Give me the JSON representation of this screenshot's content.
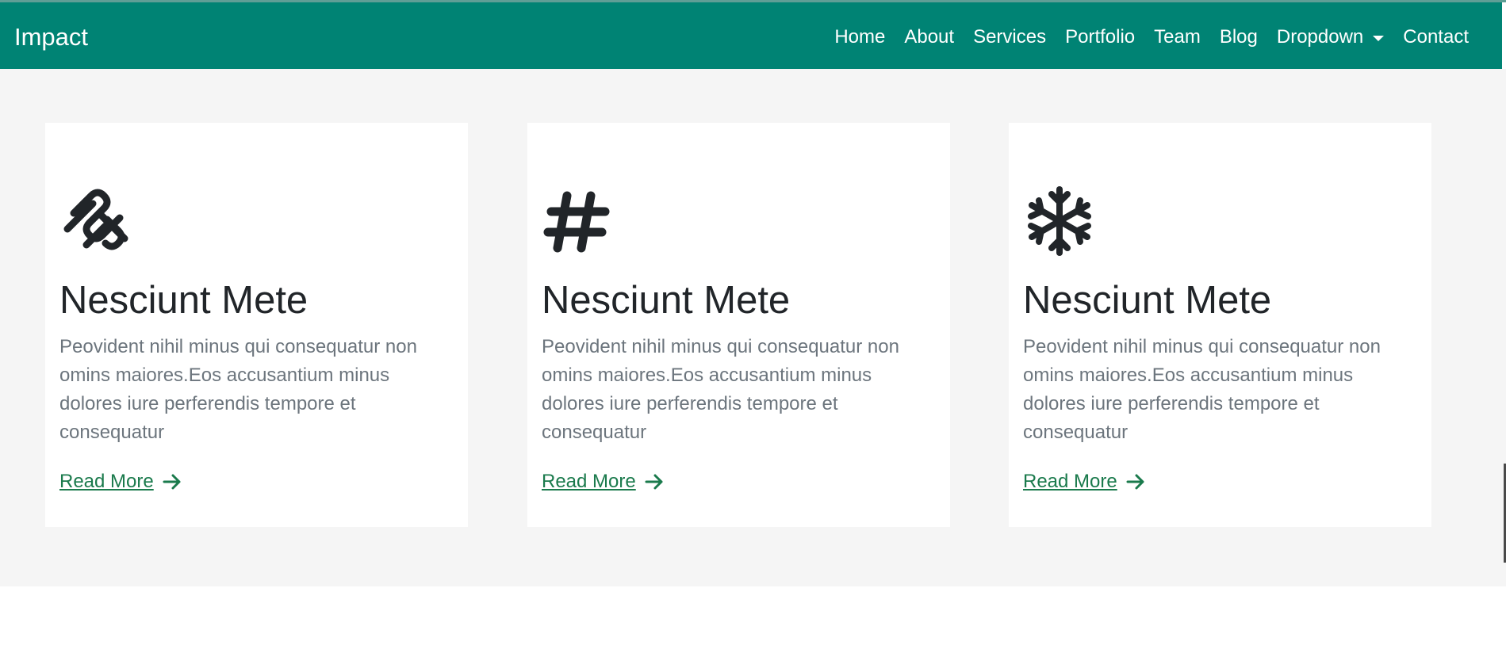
{
  "header": {
    "brand": "Impact",
    "nav": [
      {
        "label": "Home"
      },
      {
        "label": "About"
      },
      {
        "label": "Services"
      },
      {
        "label": "Portfolio"
      },
      {
        "label": "Team"
      },
      {
        "label": "Blog"
      },
      {
        "label": "Dropdown",
        "icon": "chevron-down-icon"
      },
      {
        "label": "Contact"
      }
    ]
  },
  "colors": {
    "brand": "#008374",
    "card_title": "#212529",
    "card_text": "#6c757d",
    "link": "#1a7a4c",
    "section_bg": "#f5f5f5"
  },
  "cards": [
    {
      "icon": "squarespace-icon",
      "title": "Nesciunt Mete",
      "text": "Peovident nihil minus qui consequatur non omins maiores.Eos accusantium minus dolores iure perferendis tempore et consequatur",
      "link": "Read More",
      "link_icon": "arrow-right-icon"
    },
    {
      "icon": "hashtag-icon",
      "title": "Nesciunt Mete",
      "text": "Peovident nihil minus qui consequatur non omins maiores.Eos accusantium minus dolores iure perferendis tempore et consequatur",
      "link": "Read More",
      "link_icon": "arrow-right-icon"
    },
    {
      "icon": "snowflake-icon",
      "title": "Nesciunt Mete",
      "text": "Peovident nihil minus qui consequatur non omins maiores.Eos accusantium minus dolores iure perferendis tempore et consequatur",
      "link": "Read More",
      "link_icon": "arrow-right-icon"
    }
  ]
}
